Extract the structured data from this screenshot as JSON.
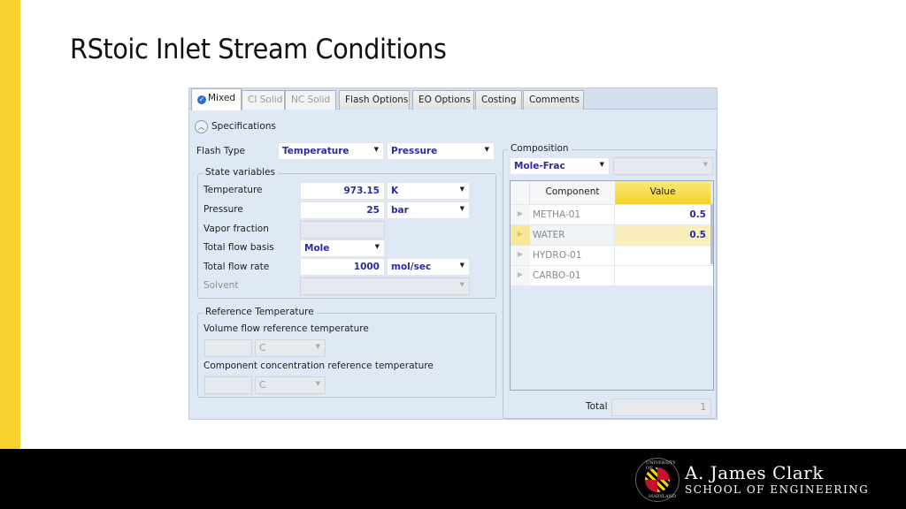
{
  "slide": {
    "title": "RStoic Inlet Stream Conditions",
    "footer": {
      "logo_title": "A. James Clark",
      "logo_subtitle": "SCHOOL OF ENGINEERING",
      "seal_top": "UNIVERSITY OF",
      "seal_bottom": "MARYLAND"
    },
    "colors": {
      "accent": "#f5d22e",
      "footer": "#000000"
    }
  },
  "tabs": [
    {
      "label": "Mixed",
      "icon": "check-circle-icon",
      "state": "active"
    },
    {
      "label": "CI Solid",
      "state": "disabled"
    },
    {
      "label": "NC Solid",
      "state": "disabled"
    },
    {
      "label": "Flash Options",
      "state": "normal"
    },
    {
      "label": "EO Options",
      "state": "normal"
    },
    {
      "label": "Costing",
      "state": "normal"
    },
    {
      "label": "Comments",
      "state": "normal"
    }
  ],
  "specifications": {
    "label": "Specifications",
    "flash_type": {
      "label": "Flash Type",
      "spec1": "Temperature",
      "spec2": "Pressure"
    },
    "state_variables": {
      "title": "State variables",
      "temperature": {
        "label": "Temperature",
        "value": "973.15",
        "unit": "K"
      },
      "pressure": {
        "label": "Pressure",
        "value": "25",
        "unit": "bar"
      },
      "vapor_fraction": {
        "label": "Vapor fraction",
        "value": ""
      },
      "total_flow_basis": {
        "label": "Total flow basis",
        "value": "Mole"
      },
      "total_flow_rate": {
        "label": "Total flow rate",
        "value": "1000",
        "unit": "mol/sec"
      },
      "solvent": {
        "label": "Solvent",
        "value": ""
      }
    },
    "reference_temperature": {
      "title": "Reference Temperature",
      "volume_flow": {
        "label": "Volume flow reference temperature",
        "value": "",
        "unit": "C"
      },
      "component_conc": {
        "label": "Component concentration reference temperature",
        "value": "",
        "unit": "C"
      }
    }
  },
  "composition": {
    "title": "Composition",
    "basis": "Mole-Frac",
    "secondary": "",
    "columns": [
      "Component",
      "Value"
    ],
    "rows": [
      {
        "component": "METHA-01",
        "value": "0.5"
      },
      {
        "component": "WATER",
        "value": "0.5"
      },
      {
        "component": "HYDRO-01",
        "value": ""
      },
      {
        "component": "CARBO-01",
        "value": ""
      }
    ],
    "total_label": "Total",
    "total_value": "1"
  }
}
